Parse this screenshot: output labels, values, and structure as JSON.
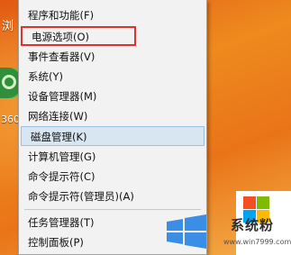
{
  "desktop": {
    "partial_glyph": "浏",
    "icon_label": "360"
  },
  "context_menu": {
    "items": [
      {
        "label": "程序和功能(F)"
      },
      {
        "label": "电源选项(O)"
      },
      {
        "label": "事件查看器(V)"
      },
      {
        "label": "系统(Y)"
      },
      {
        "label": "设备管理器(M)"
      },
      {
        "label": "网络连接(W)"
      },
      {
        "label": "磁盘管理(K)"
      },
      {
        "label": "计算机管理(G)"
      },
      {
        "label": "命令提示符(C)"
      },
      {
        "label": "命令提示符(管理员)(A)"
      },
      {
        "label": "任务管理器(T)"
      },
      {
        "label": "控制面板(P)"
      }
    ],
    "highlight_color": "#e03131",
    "hover_color": "#d8e6f2"
  },
  "watermark": {
    "brand": "系统粉",
    "url": "www.win7999.com",
    "colors": [
      "#f25022",
      "#7fba00",
      "#00a4ef",
      "#ffb900"
    ]
  }
}
